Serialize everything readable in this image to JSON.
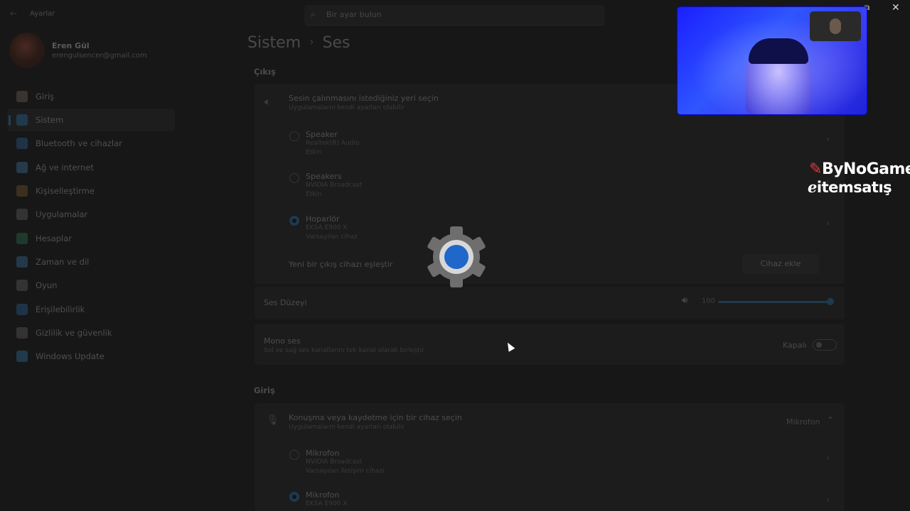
{
  "window": {
    "title": "Ayarlar",
    "restore_glyph": "⧉",
    "close_glyph": "✕"
  },
  "search": {
    "placeholder": "Bir ayar bulun"
  },
  "profile": {
    "name": "Eren Gül",
    "email": "erengulsencer@gmail.com"
  },
  "sidebar": {
    "items": [
      {
        "label": "Giriş",
        "icon": "home-icon",
        "color": "#3a3431",
        "active": false
      },
      {
        "label": "Sistem",
        "icon": "system-icon",
        "color": "#1f3a4d",
        "active": true
      },
      {
        "label": "Bluetooth ve cihazlar",
        "icon": "bluetooth-icon",
        "color": "#1e3346",
        "active": false
      },
      {
        "label": "Ağ ve internet",
        "icon": "network-icon",
        "color": "#253a4a",
        "active": false
      },
      {
        "label": "Kişiselleştirme",
        "icon": "brush-icon",
        "color": "#3a3020",
        "active": false
      },
      {
        "label": "Uygulamalar",
        "icon": "apps-icon",
        "color": "#333333",
        "active": false
      },
      {
        "label": "Hesaplar",
        "icon": "account-icon",
        "color": "#1e3a2c",
        "active": false
      },
      {
        "label": "Zaman ve dil",
        "icon": "clock-globe-icon",
        "color": "#22394a",
        "active": false
      },
      {
        "label": "Oyun",
        "icon": "gamepad-icon",
        "color": "#333333",
        "active": false
      },
      {
        "label": "Erişilebilirlik",
        "icon": "accessibility-icon",
        "color": "#1e3346",
        "active": false
      },
      {
        "label": "Gizlilik ve güvenlik",
        "icon": "shield-icon",
        "color": "#333333",
        "active": false
      },
      {
        "label": "Windows Update",
        "icon": "update-icon",
        "color": "#1f3a4d",
        "active": false
      }
    ]
  },
  "breadcrumb": {
    "parent": "Sistem",
    "separator": "›",
    "current": "Ses"
  },
  "output": {
    "section_title": "Çıkış",
    "header_title": "Sesin çalınmasını istediğiniz yeri seçin",
    "header_sub": "Uygulamaların kendi ayarları olabilir",
    "devices": [
      {
        "name": "Speaker",
        "line1": "Realtek(R) Audio",
        "line2": "Etkin",
        "selected": false
      },
      {
        "name": "Speakers",
        "line1": "NVIDIA Broadcast",
        "line2": "Etkin",
        "selected": false
      },
      {
        "name": "Hoparlör",
        "line1": "EKSA E900 X",
        "line2": "Varsayılan cihaz",
        "selected": true
      }
    ],
    "pair_label": "Yeni bir çıkış cihazı eşleştir",
    "pair_button": "Cihaz ekle",
    "volume_label": "Ses Düzeyi",
    "volume_value": "100",
    "volume_level": 1.0,
    "mono_title": "Mono ses",
    "mono_sub": "Sol ve sağ ses kanallarını tek kanal olarak birleştir",
    "mono_state": "Kapalı"
  },
  "input": {
    "section_title": "Giriş",
    "header_title": "Konuşma veya kaydetme için bir cihaz seçin",
    "header_sub": "Uygulamaların kendi ayarları olabilir",
    "selected_device": "Mikrofon",
    "devices": [
      {
        "name": "Mikrofon",
        "line1": "NVIDIA Broadcast",
        "line2": "Varsayılan iletişim cihazı",
        "selected": false
      },
      {
        "name": "Mikrofon",
        "line1": "EKSA E900 X",
        "line2": "",
        "selected": true
      }
    ]
  },
  "overlay": {
    "loading_icon": "settings-gear-icon",
    "logo_brand_1": "ByNoGame",
    "logo_brand_2": "itemsatış",
    "brand_color": "#e53935"
  }
}
